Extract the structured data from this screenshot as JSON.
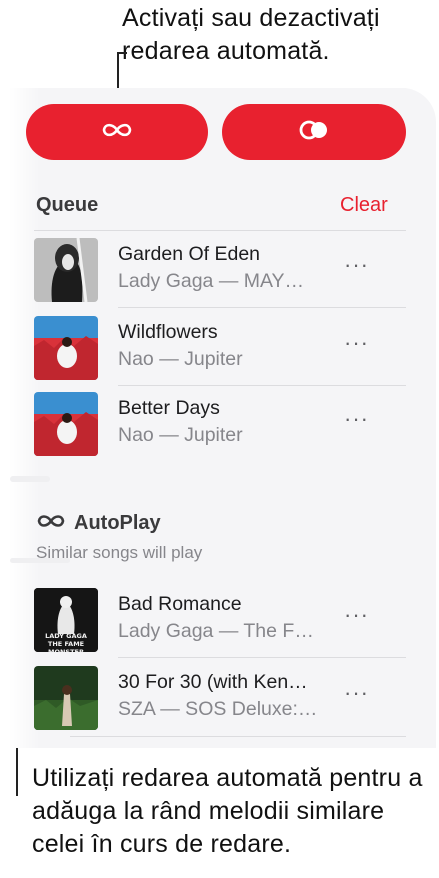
{
  "callouts": {
    "top": "Activați sau dezactivați redarea automată.",
    "bottom": "Utilizați redarea automată pentru a adăuga la rând melodii similare celei în curs de redare."
  },
  "toolbar": {
    "autoplay_icon": "infinity-icon",
    "shared_icon": "infinity-ring-icon",
    "accent": "#e8212f"
  },
  "queue": {
    "title": "Queue",
    "clear_label": "Clear",
    "items": [
      {
        "title": "Garden Of Eden",
        "subtitle": "Lady Gaga — MAY…",
        "more": "···"
      },
      {
        "title": "Wildflowers",
        "subtitle": "Nao — Jupiter",
        "more": "···"
      },
      {
        "title": "Better Days",
        "subtitle": "Nao — Jupiter",
        "more": "···"
      }
    ]
  },
  "autoplay": {
    "title": "AutoPlay",
    "subtitle": "Similar songs will play",
    "items": [
      {
        "title": "Bad Romance",
        "subtitle": "Lady Gaga — The F…",
        "more": "···",
        "art_text_1": "LADY GAGA",
        "art_text_2": "THE FAME MONSTER"
      },
      {
        "title": "30 For 30 (with Ken…",
        "subtitle": "SZA — SOS Deluxe:…",
        "more": "···"
      }
    ]
  }
}
